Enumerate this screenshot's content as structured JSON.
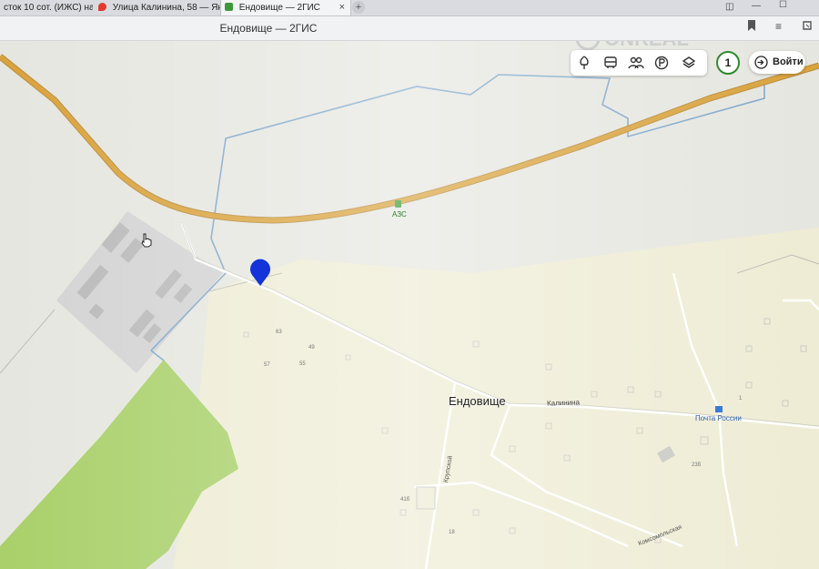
{
  "tabs": [
    {
      "label": "сток 10 сот. (ИЖС) на"
    },
    {
      "label": "Улица Калинина, 58 — Ян"
    },
    {
      "label": "Ендовище — 2ГИС",
      "close": "×"
    }
  ],
  "newtab_label": "+",
  "window": {
    "title": "Ендовище — 2ГИС"
  },
  "toolbar": {
    "tools": [
      "tree-icon",
      "bus-icon",
      "people-icon",
      "parking-icon",
      "layers-icon"
    ]
  },
  "notifications": {
    "count": "1"
  },
  "login": {
    "label": "Войти"
  },
  "map": {
    "village_label": "Ендовище",
    "gas_station": "АЗС",
    "post_office": "Почта России",
    "streets": {
      "kalinina": "Калинина",
      "krupskoy": "Крупской",
      "komsomolskaya": "Комсомольская"
    },
    "house_numbers": {
      "h63": "63",
      "h57": "57",
      "h55": "55",
      "h49": "49",
      "h41b": "41б",
      "h18": "18",
      "h23": "23б",
      "h1": "1"
    }
  },
  "colors": {
    "highway": "#d9a23b",
    "forest": "#a9d06a",
    "boundary": "#7da7c9",
    "pin": "#1433d9"
  }
}
